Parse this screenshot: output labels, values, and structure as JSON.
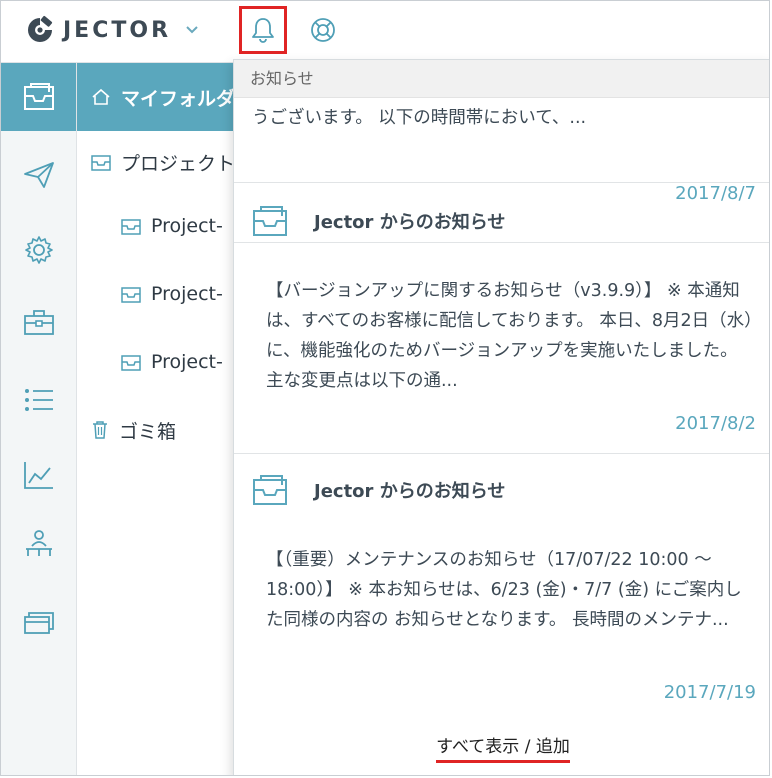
{
  "header": {
    "logo_text": "JECTOR",
    "icons": {
      "logo": "jector-logo-icon",
      "menu": "chevron-down-icon",
      "notifications": "bell-icon",
      "help": "lifebuoy-icon"
    }
  },
  "rail": {
    "items": [
      {
        "name": "inbox-icon",
        "active": true
      },
      {
        "name": "paper-plane-icon",
        "active": false
      },
      {
        "name": "gear-icon",
        "active": false
      },
      {
        "name": "briefcase-icon",
        "active": false
      },
      {
        "name": "list-icon",
        "active": false
      },
      {
        "name": "line-chart-icon",
        "active": false
      },
      {
        "name": "org-chart-icon",
        "active": false
      },
      {
        "name": "cards-icon",
        "active": false
      }
    ]
  },
  "tree": {
    "my_folder": "マイフォルダ",
    "projects": "プロジェクト",
    "project_items": [
      "Project-",
      "Project-",
      "Project-"
    ],
    "trash": "ゴミ箱"
  },
  "notifications": {
    "panel_title": "お知らせ",
    "items": [
      {
        "title": "",
        "body": "うございます。 以下の時間帯において、...",
        "date": "2017/8/7"
      },
      {
        "title": "Jector からのお知らせ",
        "body": "【バージョンアップに関するお知らせ（v3.9.9）】 ※ 本通知は、すべてのお客様に配信しております。 本日、8月2日（水）に、機能強化のためバージョンアップを実施いたしました。 主な変更点は以下の通...",
        "date": "2017/8/2"
      },
      {
        "title": "Jector からのお知らせ",
        "body": "【（重要）メンテナンスのお知らせ（17/07/22 10:00 〜 18:00）】 ※ 本お知らせは、6/23 (金)・7/7 (金) にご案内した同様の内容の お知らせとなります。 長時間のメンテナ...",
        "date": "2017/7/19"
      }
    ],
    "footer_link": "すべて表示 / 追加"
  },
  "colors": {
    "accent": "#5aa7bd",
    "highlight": "#e02424",
    "text": "#3d4a55"
  }
}
